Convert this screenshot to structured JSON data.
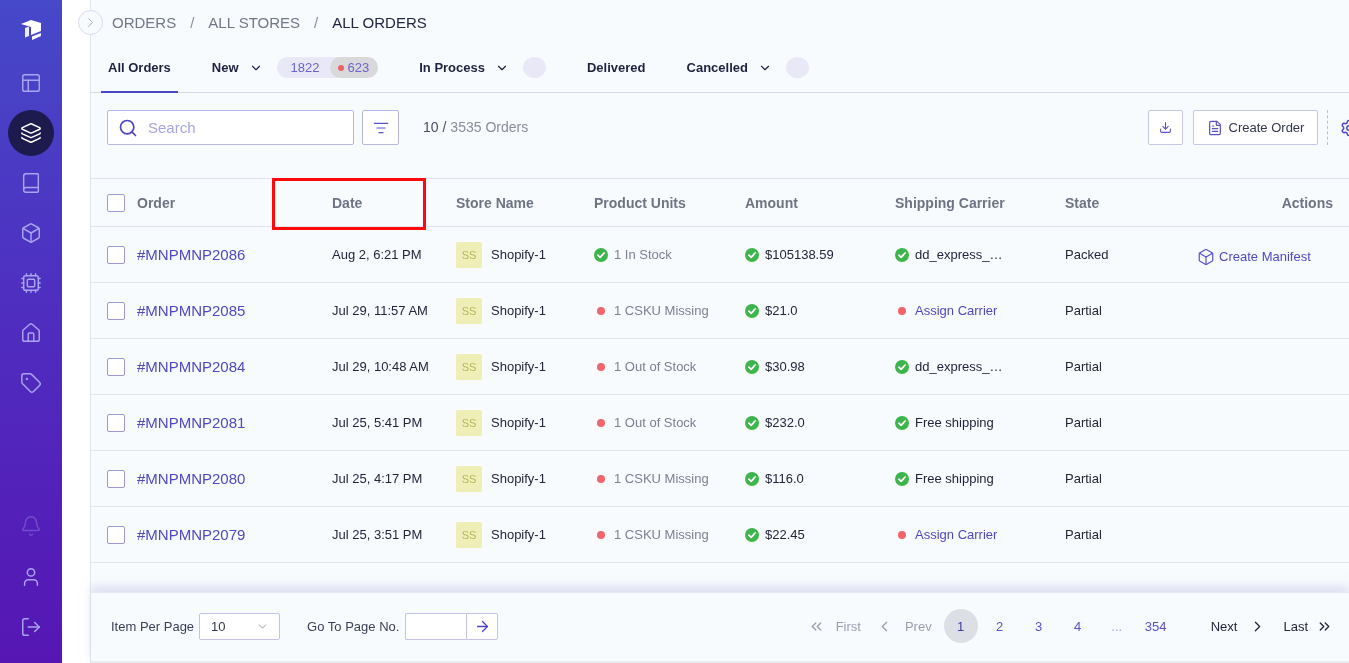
{
  "sidebar": {
    "nav_items": [
      {
        "selected": false
      },
      {
        "selected": true
      },
      {
        "selected": false
      },
      {
        "selected": false
      },
      {
        "selected": false
      },
      {
        "selected": false
      },
      {
        "selected": false
      }
    ],
    "bottom_items": [
      {
        "disabled": true
      },
      {
        "disabled": false
      },
      {
        "disabled": false
      }
    ]
  },
  "breadcrumb": [
    {
      "label": "ORDERS",
      "current": false,
      "separator": "/"
    },
    {
      "label": "ALL STORES",
      "current": false,
      "separator": "/"
    },
    {
      "label": "ALL ORDERS",
      "current": true
    }
  ],
  "tabs": [
    {
      "label": "All Orders",
      "selected": true,
      "dropdown": false
    },
    {
      "label": "New",
      "selected": false,
      "dropdown": true,
      "badges": [
        {
          "kind": "count",
          "text": "1822"
        },
        {
          "kind": "alert",
          "text": "623"
        }
      ]
    },
    {
      "label": "In Process",
      "selected": false,
      "dropdown": true,
      "badges": [
        {
          "kind": "blank"
        }
      ]
    },
    {
      "label": "Delivered",
      "selected": false,
      "dropdown": false
    },
    {
      "label": "Cancelled",
      "selected": false,
      "dropdown": true,
      "badges": [
        {
          "kind": "blank"
        }
      ]
    }
  ],
  "toolbar": {
    "search": {
      "placeholder": "Search"
    },
    "count": {
      "shown": "10 /",
      "total": "3535 Orders"
    },
    "create_button": "Create Order"
  },
  "table": {
    "select_all": {
      "checked": false
    },
    "columns": [
      {
        "label": "Order",
        "highlighted": false
      },
      {
        "label": "Date",
        "highlighted": true
      },
      {
        "label": "Store Name",
        "highlighted": false
      },
      {
        "label": "Product Units",
        "highlighted": false
      },
      {
        "label": "Amount",
        "highlighted": false
      },
      {
        "label": "Shipping Carrier",
        "highlighted": false
      },
      {
        "label": "State",
        "highlighted": false
      },
      {
        "label": "Actions",
        "highlighted": false
      }
    ],
    "rows": [
      {
        "checked": false,
        "order": "#MNPMNP2086",
        "date": "Aug 2, 6:21 PM",
        "store": {
          "initials": "SS",
          "name": "Shopify-1"
        },
        "units": {
          "text": "1 In Stock",
          "ok": true
        },
        "amount": {
          "text": "$105138.59",
          "ok": true
        },
        "carrier": {
          "text": "dd_express_…",
          "ok": true
        },
        "state": "Packed",
        "action": "Create Manifest"
      },
      {
        "checked": false,
        "order": "#MNPMNP2085",
        "date": "Jul 29, 11:57 AM",
        "store": {
          "initials": "SS",
          "name": "Shopify-1"
        },
        "units": {
          "text": "1 CSKU Missing",
          "ok": false
        },
        "amount": {
          "text": "$21.0",
          "ok": true
        },
        "carrier": {
          "text": "Assign Carrier",
          "ok": false
        },
        "state": "Partial"
      },
      {
        "checked": false,
        "order": "#MNPMNP2084",
        "date": "Jul 29, 10:48 AM",
        "store": {
          "initials": "SS",
          "name": "Shopify-1"
        },
        "units": {
          "text": "1 Out of Stock",
          "ok": false
        },
        "amount": {
          "text": "$30.98",
          "ok": true
        },
        "carrier": {
          "text": "dd_express_…",
          "ok": true
        },
        "state": "Partial"
      },
      {
        "checked": false,
        "order": "#MNPMNP2081",
        "date": "Jul 25, 5:41 PM",
        "store": {
          "initials": "SS",
          "name": "Shopify-1"
        },
        "units": {
          "text": "1 Out of Stock",
          "ok": false
        },
        "amount": {
          "text": "$232.0",
          "ok": true
        },
        "carrier": {
          "text": "Free shipping",
          "ok": true
        },
        "state": "Partial"
      },
      {
        "checked": false,
        "order": "#MNPMNP2080",
        "date": "Jul 25, 4:17 PM",
        "store": {
          "initials": "SS",
          "name": "Shopify-1"
        },
        "units": {
          "text": "1 CSKU Missing",
          "ok": false
        },
        "amount": {
          "text": "$116.0",
          "ok": true
        },
        "carrier": {
          "text": "Free shipping",
          "ok": true
        },
        "state": "Partial"
      },
      {
        "checked": false,
        "order": "#MNPMNP2079",
        "date": "Jul 25, 3:51 PM",
        "store": {
          "initials": "SS",
          "name": "Shopify-1"
        },
        "units": {
          "text": "1 CSKU Missing",
          "ok": false
        },
        "amount": {
          "text": "$22.45",
          "ok": true
        },
        "carrier": {
          "text": "Assign Carrier",
          "ok": false
        },
        "state": "Partial"
      }
    ]
  },
  "footer": {
    "per_page": {
      "label": "Item Per Page",
      "value": "10"
    },
    "goto": {
      "label": "Go To Page No."
    },
    "pagination": {
      "first": {
        "label": "First",
        "disabled": true
      },
      "prev": {
        "label": "Prev",
        "disabled": true
      },
      "pages": [
        {
          "kind": "page",
          "label": "1",
          "selected": true
        },
        {
          "kind": "page",
          "label": "2",
          "selected": false
        },
        {
          "kind": "page",
          "label": "3",
          "selected": false
        },
        {
          "kind": "page",
          "label": "4",
          "selected": false
        },
        {
          "kind": "gap",
          "label": "..."
        },
        {
          "kind": "page",
          "label": "354",
          "selected": false
        }
      ],
      "next": {
        "label": "Next",
        "disabled": false
      },
      "last": {
        "label": "Last",
        "disabled": false
      }
    }
  }
}
